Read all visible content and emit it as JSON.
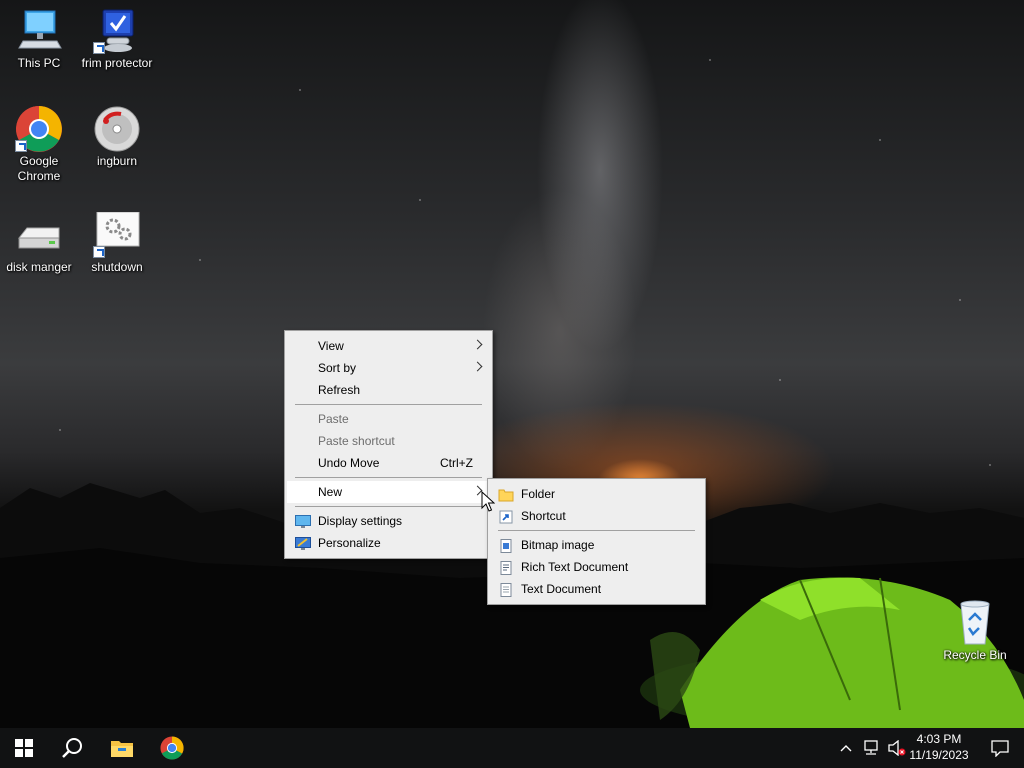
{
  "desktop": {
    "icons": [
      {
        "label": "This PC",
        "icon": "this-pc-icon"
      },
      {
        "label": "frim protector",
        "icon": "frim-protector-icon"
      },
      {
        "label": "Google Chrome",
        "icon": "chrome-icon"
      },
      {
        "label": "ingburn",
        "icon": "ingburn-icon"
      },
      {
        "label": "disk manger",
        "icon": "disk-manager-icon"
      },
      {
        "label": "shutdown",
        "icon": "shutdown-icon"
      },
      {
        "label": "Recycle Bin",
        "icon": "recycle-bin-icon"
      }
    ]
  },
  "context_menu": {
    "items": [
      {
        "label": "View",
        "submenu": true
      },
      {
        "label": "Sort by",
        "submenu": true
      },
      {
        "label": "Refresh"
      },
      {
        "label": "Paste",
        "disabled": true
      },
      {
        "label": "Paste shortcut",
        "disabled": true
      },
      {
        "label": "Undo Move",
        "shortcut": "Ctrl+Z"
      },
      {
        "label": "New",
        "submenu": true,
        "highlighted": true
      },
      {
        "label": "Display settings",
        "icon": "display-settings-icon"
      },
      {
        "label": "Personalize",
        "icon": "personalize-icon"
      }
    ]
  },
  "new_submenu": {
    "items": [
      {
        "label": "Folder",
        "icon": "folder-icon"
      },
      {
        "label": "Shortcut",
        "icon": "shortcut-icon"
      },
      {
        "label": "Bitmap image",
        "icon": "bitmap-icon"
      },
      {
        "label": "Rich Text Document",
        "icon": "rtf-document-icon"
      },
      {
        "label": "Text Document",
        "icon": "text-document-icon"
      }
    ]
  },
  "taskbar": {
    "time": "4:03 PM",
    "date": "11/19/2023",
    "pinned": [
      "start-icon",
      "search-icon",
      "file-explorer-icon",
      "chrome-icon"
    ],
    "tray": [
      "show-hidden-icons-chevron-icon",
      "network-icon",
      "volume-muted-icon",
      "notifications-icon"
    ]
  },
  "colors": {
    "menu_bg": "#eeeeee",
    "menu_hover": "#ffffff",
    "taskbar_bg": "#111213",
    "accent_blue": "#1c64c8"
  }
}
